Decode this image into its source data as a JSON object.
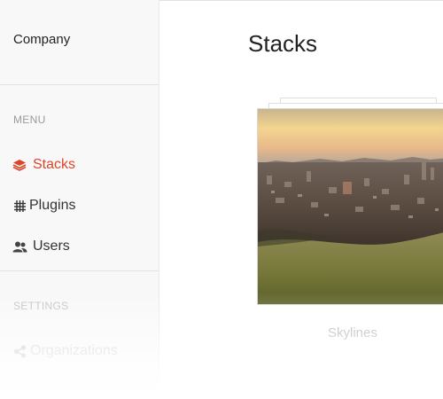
{
  "sidebar": {
    "company": "Company",
    "menu_label": "MENU",
    "menu_items": [
      {
        "label": "Stacks",
        "icon": "layers-icon",
        "active": true
      },
      {
        "label": "Plugins",
        "icon": "hashtag-icon",
        "active": false
      },
      {
        "label": "Users",
        "icon": "users-icon",
        "active": false
      }
    ],
    "settings_label": "SETTINGS",
    "settings_items": [
      {
        "label": "Organizations",
        "icon": "share-icon"
      }
    ]
  },
  "main": {
    "title": "Stacks",
    "stacks": [
      {
        "name": "Skylines"
      }
    ]
  },
  "colors": {
    "accent": "#d9472b",
    "sidebar_bg": "#f8f8f8",
    "text": "#333333",
    "muted": "#9a9a9a"
  }
}
